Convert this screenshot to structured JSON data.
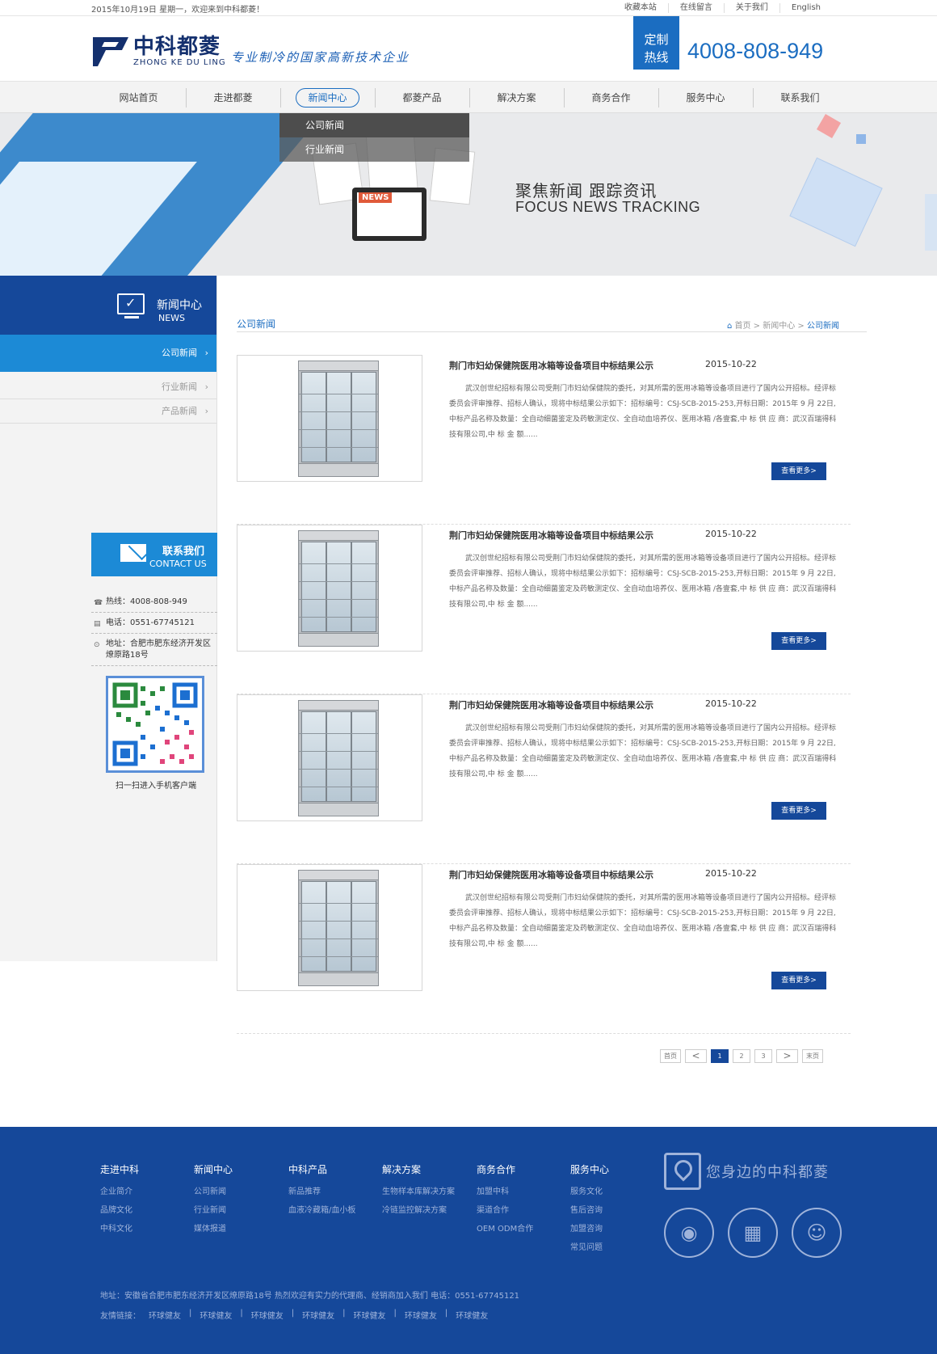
{
  "topbar": {
    "date": "2015年10月19日  星期一，欢迎来到中科都菱！",
    "links": [
      "收藏本站",
      "在线留言",
      "关于我们",
      "English"
    ]
  },
  "header": {
    "logo_cn": "中科都菱",
    "logo_en": "ZHONG KE DU LING",
    "slogan": "专业制冷的国家高新技术企业",
    "hotline_label_1": "定制",
    "hotline_label_2": "热线",
    "hotline_number": "4008-808-949"
  },
  "nav": {
    "items": [
      "网站首页",
      "走进都菱",
      "新闻中心",
      "都菱产品",
      "解决方案",
      "商务合作",
      "服务中心",
      "联系我们"
    ],
    "active_index": 2,
    "dropdown": [
      "公司新闻",
      "行业新闻"
    ]
  },
  "banner": {
    "title_cn": "聚焦新闻 跟踪资讯",
    "title_en": "FOCUS NEWS TRACKING",
    "tablet_label": "NEWS"
  },
  "sidebar": {
    "head_cn": "新闻中心",
    "head_en": "NEWS",
    "items": [
      "公司新闻",
      "行业新闻",
      "产品新闻"
    ],
    "contact_cn": "联系我们",
    "contact_en": "CONTACT US",
    "hotline": "热线：4008-808-949",
    "phone": "电话：0551-67745121",
    "address": "地址：合肥市肥东经济开发区 燎原路18号",
    "qr_caption": "扫一扫进入手机客户端"
  },
  "main": {
    "section_title": "公司新闻",
    "breadcrumb": [
      "首页",
      "新闻中心",
      "公司新闻"
    ],
    "news": [
      {
        "title": "荆门市妇幼保健院医用冰箱等设备项目中标结果公示",
        "date": "2015-10-22",
        "desc": "武汉创世纪招标有限公司受荆门市妇幼保健院的委托，对其所需的医用冰箱等设备项目进行了国内公开招标。经评标委员会评审推荐、招标人确认，现将中标结果公示如下：招标编号：CSJ-SCB-2015-253,开标日期：2015年 9 月 22日,中标产品名称及数量：全自动细菌鉴定及药敏测定仪、全自动血培养仪、医用冰箱 /各壹套,中 标 供 应 商：武汉百瑞得科技有限公司,中 标 金 额......",
        "more": "查看更多>"
      },
      {
        "title": "荆门市妇幼保健院医用冰箱等设备项目中标结果公示",
        "date": "2015-10-22",
        "desc": "武汉创世纪招标有限公司受荆门市妇幼保健院的委托，对其所需的医用冰箱等设备项目进行了国内公开招标。经评标委员会评审推荐、招标人确认，现将中标结果公示如下：招标编号：CSJ-SCB-2015-253,开标日期：2015年 9 月 22日,中标产品名称及数量：全自动细菌鉴定及药敏测定仪、全自动血培养仪、医用冰箱 /各壹套,中 标 供 应 商：武汉百瑞得科技有限公司,中 标 金 额......",
        "more": "查看更多>"
      },
      {
        "title": "荆门市妇幼保健院医用冰箱等设备项目中标结果公示",
        "date": "2015-10-22",
        "desc": "武汉创世纪招标有限公司受荆门市妇幼保健院的委托，对其所需的医用冰箱等设备项目进行了国内公开招标。经评标委员会评审推荐、招标人确认，现将中标结果公示如下：招标编号：CSJ-SCB-2015-253,开标日期：2015年 9 月 22日,中标产品名称及数量：全自动细菌鉴定及药敏测定仪、全自动血培养仪、医用冰箱 /各壹套,中 标 供 应 商：武汉百瑞得科技有限公司,中 标 金 额......",
        "more": "查看更多>"
      },
      {
        "title": "荆门市妇幼保健院医用冰箱等设备项目中标结果公示",
        "date": "2015-10-22",
        "desc": "武汉创世纪招标有限公司受荆门市妇幼保健院的委托，对其所需的医用冰箱等设备项目进行了国内公开招标。经评标委员会评审推荐、招标人确认，现将中标结果公示如下：招标编号：CSJ-SCB-2015-253,开标日期：2015年 9 月 22日,中标产品名称及数量：全自动细菌鉴定及药敏测定仪、全自动血培养仪、医用冰箱 /各壹套,中 标 供 应 商：武汉百瑞得科技有限公司,中 标 金 额......",
        "more": "查看更多>"
      }
    ],
    "pager": {
      "first": "首页",
      "prev": "<",
      "pages": [
        "1",
        "2",
        "3"
      ],
      "current": "1",
      "next": ">",
      "last": "末页"
    }
  },
  "footer": {
    "columns": [
      {
        "head": "走进中科",
        "items": [
          "企业简介",
          "品牌文化",
          "中科文化"
        ]
      },
      {
        "head": "新闻中心",
        "items": [
          "公司新闻",
          "行业新闻",
          "媒体报道"
        ]
      },
      {
        "head": "中科产品",
        "items": [
          "新品推荐",
          "血液冷藏箱/血小板"
        ]
      },
      {
        "head": "解决方案",
        "items": [
          "生物样本库解决方案",
          "冷链监控解决方案"
        ]
      },
      {
        "head": "商务合作",
        "items": [
          "加盟中科",
          "渠道合作",
          "OEM ODM合作"
        ]
      },
      {
        "head": "服务中心",
        "items": [
          "服务文化",
          "售后咨询",
          "加盟咨询",
          "常见问题"
        ]
      }
    ],
    "tagline": "您身边的中科都菱",
    "social_icons": [
      "weibo-icon",
      "qr-code-icon",
      "qq-icon"
    ],
    "address": "地址：安徽省合肥市肥东经济开发区燎原路18号   热烈欢迎有实力的代理商、经销商加入我们   电话：0551-67745121",
    "links_label": "友情链接：",
    "links": [
      "环球健友",
      "环球健友",
      "环球健友",
      "环球健友",
      "环球健友",
      "环球健友",
      "环球健友"
    ]
  },
  "colors": {
    "brand_blue": "#15489a",
    "accent_blue": "#1b6dc1",
    "sidebar_active": "#1c8ad6"
  }
}
